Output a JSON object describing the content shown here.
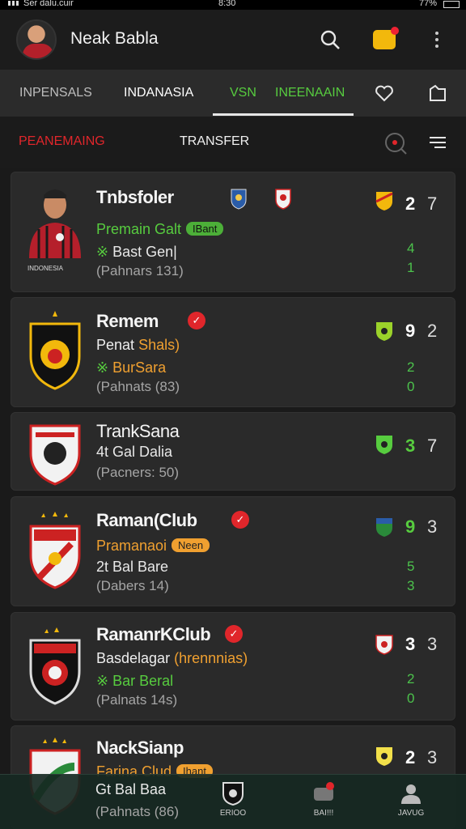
{
  "status_bar": {
    "left": "Ser dalu.cuir",
    "time": "8:30",
    "battery": "77%"
  },
  "header": {
    "title": "Neak Babla"
  },
  "tabs": [
    {
      "label": "INPENSALS"
    },
    {
      "label": "INDANASIA"
    },
    {
      "label": "VSN"
    },
    {
      "label": "INEENAAIN"
    }
  ],
  "subtabs": {
    "left": "PEANEMAING",
    "right": "TRANSFER"
  },
  "cards": [
    {
      "name": "Tnbsfoler",
      "line2": "Premain Galt",
      "tag": "IBant",
      "line3": "Bast Gen|",
      "line4": "(Pahnars 131)",
      "score_a": "2",
      "score_b": "7",
      "stat1": "4",
      "stat2": "1",
      "photo_caption": "INDONESIA"
    },
    {
      "name": "Remem",
      "line2_a": "Penat",
      "line2_b": "Shals)",
      "line3": "BurSara",
      "line4": "(Pahnats (83)",
      "score_a": "9",
      "score_b": "2",
      "stat1": "2",
      "stat2": "0"
    },
    {
      "name": "TrankSana",
      "line2": "4t Gal Dalia",
      "line4": "(Pacners: 50)",
      "score_a": "3",
      "score_b": "7"
    },
    {
      "name": "Raman(Club",
      "line2": "Pramanaoi",
      "tag": "Neen",
      "line3": "2t Bal Bare",
      "line4": "(Dabers 14)",
      "score_a": "9",
      "score_b": "3",
      "stat1": "5",
      "stat2": "3"
    },
    {
      "name": "RamanrKClub",
      "line2_a": "Basdelagar",
      "line2_b": "(hrennnias)",
      "line3": "Bar Beral",
      "line4": "(Palnats 14s)",
      "score_a": "3",
      "score_b": "3",
      "stat1": "2",
      "stat2": "0"
    },
    {
      "name": "NackSianp",
      "line2": "Farina Clud",
      "tag": "Ihant",
      "line3": "Gt Bal Baa",
      "line4": "(Pahnats (86)",
      "score_a": "2",
      "score_b": "3"
    }
  ],
  "bottom_nav": [
    {
      "label": "ERIOO"
    },
    {
      "label": "BAI!!!"
    },
    {
      "label": "JAVUG"
    }
  ],
  "colors": {
    "accent_red": "#e0262b",
    "accent_green": "#57cc3f",
    "accent_orange": "#f0a030",
    "badge_yellow": "#f2b80c"
  }
}
